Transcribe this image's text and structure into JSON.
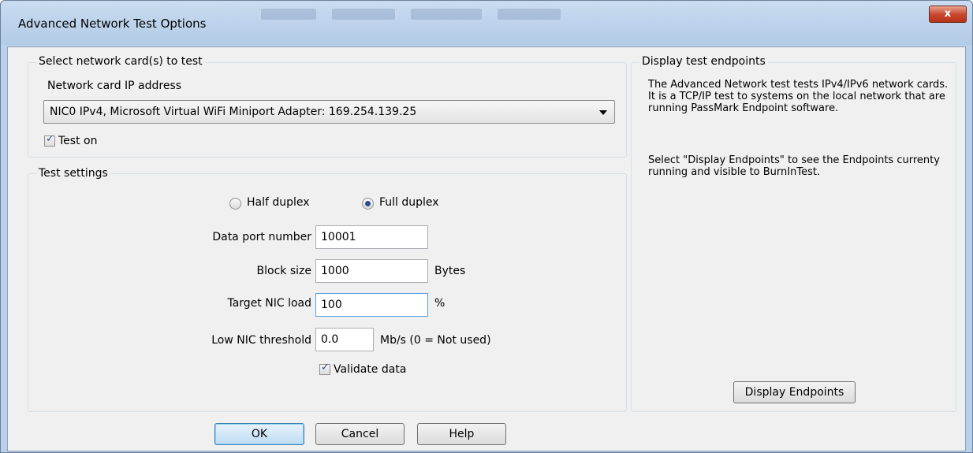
{
  "window": {
    "title": "Advanced Network Test Options",
    "close_label": "x"
  },
  "network_group": {
    "legend": "Select network card(s) to test",
    "ip_label": "Network card IP address",
    "selected_card": "NIC0 IPv4, Microsoft Virtual WiFi Miniport Adapter: 169.254.139.25",
    "test_on_label": "Test on",
    "test_on_checked": true
  },
  "settings_group": {
    "legend": "Test settings",
    "half_duplex_label": "Half duplex",
    "full_duplex_label": "Full duplex",
    "duplex_selected": "Full duplex",
    "data_port_label": "Data port number",
    "data_port_value": "10001",
    "block_size_label": "Block size",
    "block_size_value": "1000",
    "block_size_unit": "Bytes",
    "target_load_label": "Target NIC load",
    "target_load_value": "100",
    "target_load_unit": "%",
    "low_threshold_label": "Low NIC threshold",
    "low_threshold_value": "0.0",
    "low_threshold_unit": "Mb/s (0 = Not used)",
    "validate_label": "Validate data",
    "validate_checked": true
  },
  "endpoints_group": {
    "legend": "Display test endpoints",
    "description_1": "The Advanced Network test tests IPv4/IPv6 network cards. It is a TCP/IP test to systems on the local network that are running PassMark Endpoint software.",
    "description_2": "Select \"Display Endpoints\" to see the Endpoints currenty running and visible to BurnInTest.",
    "button_label": "Display Endpoints"
  },
  "footer": {
    "ok_label": "OK",
    "cancel_label": "Cancel",
    "help_label": "Help"
  },
  "colors": {
    "window_frame": "#b9d1ea",
    "close_button": "#c7432a",
    "dialog_bg": "#f0f0f0",
    "focus_border": "#569de5"
  }
}
